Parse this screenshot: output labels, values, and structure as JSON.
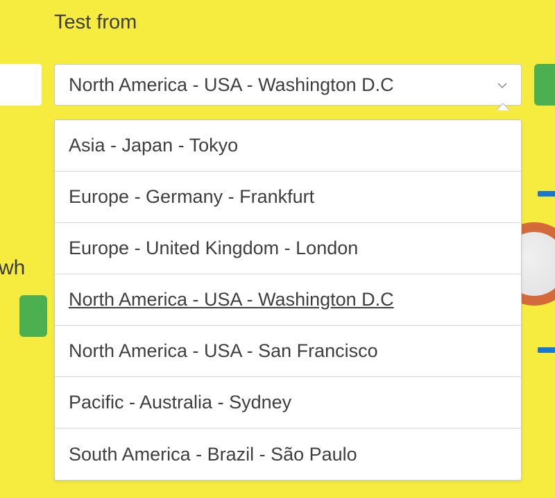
{
  "label": "Test from",
  "dropdown": {
    "selected": "North America - USA - Washington D.C",
    "highlighted_index": 3,
    "options": [
      "Asia - Japan - Tokyo",
      "Europe - Germany - Frankfurt",
      "Europe - United Kingdom - London",
      "North America - USA - Washington D.C",
      "North America - USA - San Francisco",
      "Pacific - Australia - Sydney",
      "South America - Brazil - São Paulo"
    ]
  },
  "background_text": "wh"
}
